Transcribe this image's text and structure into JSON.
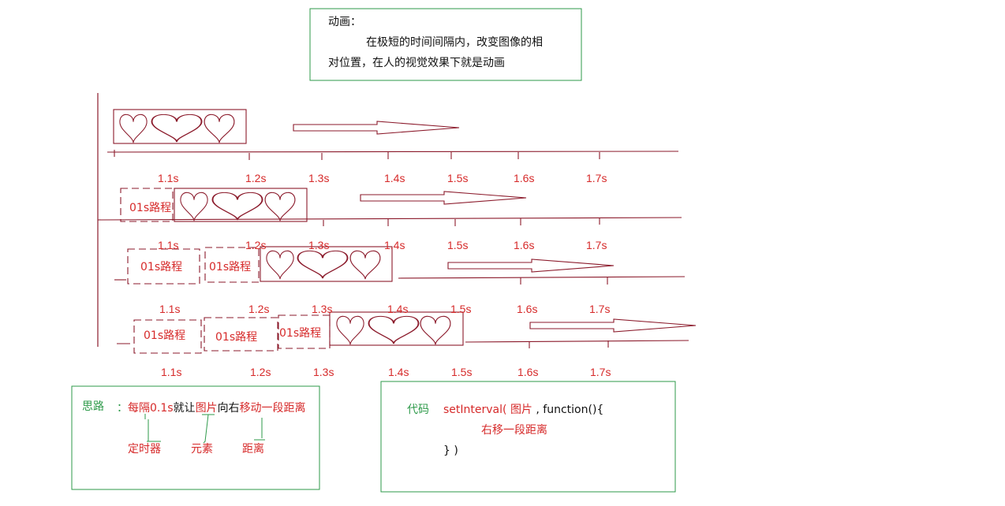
{
  "definition": {
    "title": "动画：",
    "text_line1": "在极短的时间间隔内，改变图像的相",
    "text_line2": "对位置，在人的视觉效果下就是动画"
  },
  "timeline": {
    "ticks": [
      "1.1s",
      "1.2s",
      "1.3s",
      "1.4s",
      "1.5s",
      "1.6s",
      "1.7s"
    ],
    "row2_partial": [
      "1.1s",
      "1.2s",
      "1.3s"
    ],
    "row3_partial": [
      "1.3s",
      "1.4s",
      "1.5s"
    ],
    "path_label": "01s路程"
  },
  "idea": {
    "label": "思路",
    "colon": "：",
    "parts": [
      "每隔0.1s",
      "就让",
      "图片",
      "向右",
      "移动一段距离"
    ],
    "timer": "定时器",
    "element": "元素",
    "distance": "距离"
  },
  "code": {
    "label": "代码",
    "fn": "setInterval(",
    "arg": "图片",
    "rest": ", function(){",
    "body": "右移一段距离",
    "close": "} )"
  },
  "colors": {
    "line": "#8b1a2b",
    "label_red": "#d62a2a",
    "box_green": "#2e9a4a"
  }
}
